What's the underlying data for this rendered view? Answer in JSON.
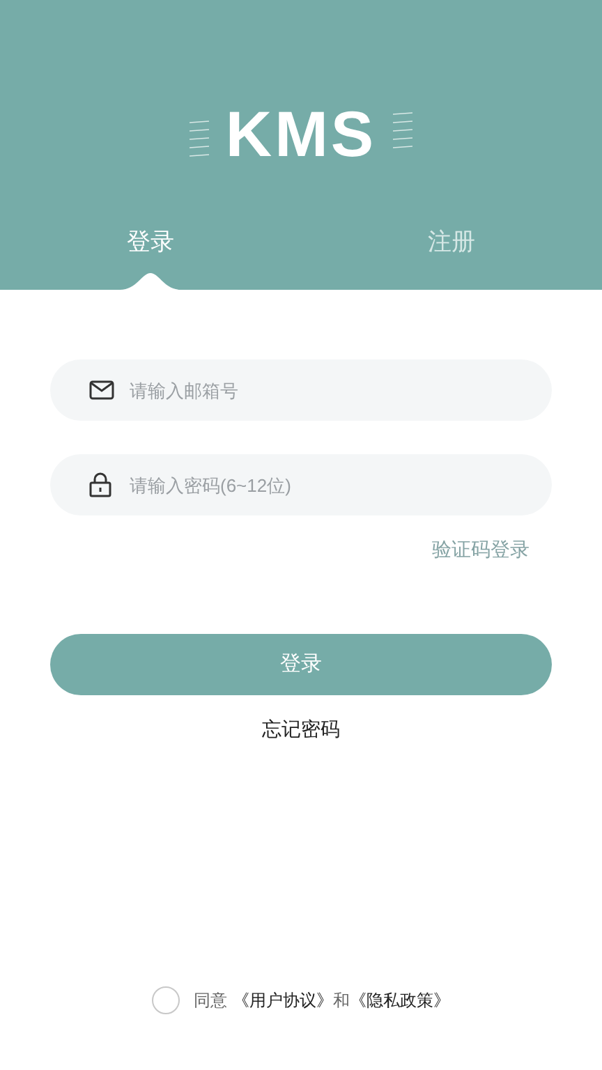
{
  "logo": {
    "text": "KMS"
  },
  "tabs": [
    {
      "label": "登录",
      "selected": true
    },
    {
      "label": "注册",
      "selected": false
    }
  ],
  "fields": [
    {
      "kind": "email",
      "placeholder": "请输入邮箱号"
    },
    {
      "kind": "password",
      "placeholder": "请输入密码(6~12位)"
    }
  ],
  "code_login_link": "验证码登录",
  "login_button": "登录",
  "forgot_link": "忘记密码",
  "agreement": {
    "checked": false,
    "prefix": "同意",
    "links": [
      "《用户协议》",
      "《隐私政策》"
    ],
    "joiner": "和"
  }
}
